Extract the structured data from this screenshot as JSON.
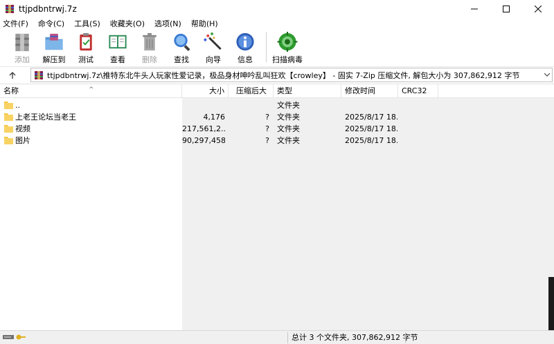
{
  "window": {
    "title": "ttjpdbntrwj.7z"
  },
  "menu": [
    "文件(F)",
    "命令(C)",
    "工具(S)",
    "收藏夹(O)",
    "选项(N)",
    "帮助(H)"
  ],
  "toolbar": {
    "add": "添加",
    "extract": "解压到",
    "test": "测试",
    "view": "查看",
    "delete": "删除",
    "find": "查找",
    "wizard": "向导",
    "info": "信息",
    "scan": "扫描病毒"
  },
  "address": {
    "path": "ttjpdbntrwj.7z\\推特东北牛头人玩家性爱记录，极品身材呻吟乱叫狂欢【crowley】 - 固实 7-Zip 压缩文件, 解包大小为 307,862,912 字节"
  },
  "columns": {
    "name": "名称",
    "size": "大小",
    "packed": "压缩后大小",
    "type": "类型",
    "modified": "修改时间",
    "crc": "CRC32"
  },
  "files": [
    {
      "name": "..",
      "size": "",
      "packed": "",
      "type": "文件夹",
      "modified": "",
      "crc": ""
    },
    {
      "name": "上老王论坛当老王",
      "size": "4,176",
      "packed": "?",
      "type": "文件夹",
      "modified": "2025/8/17 18...",
      "crc": ""
    },
    {
      "name": "视频",
      "size": "217,561,2...",
      "packed": "?",
      "type": "文件夹",
      "modified": "2025/8/17 18...",
      "crc": ""
    },
    {
      "name": "图片",
      "size": "90,297,458",
      "packed": "?",
      "type": "文件夹",
      "modified": "2025/8/17 18...",
      "crc": ""
    }
  ],
  "status": {
    "summary": "总计 3 个文件夹, 307,862,912 字节"
  },
  "colors": {
    "folder": "#f5c542",
    "list_bg": "#ffffff",
    "grey_bg": "#f0f0f0"
  }
}
